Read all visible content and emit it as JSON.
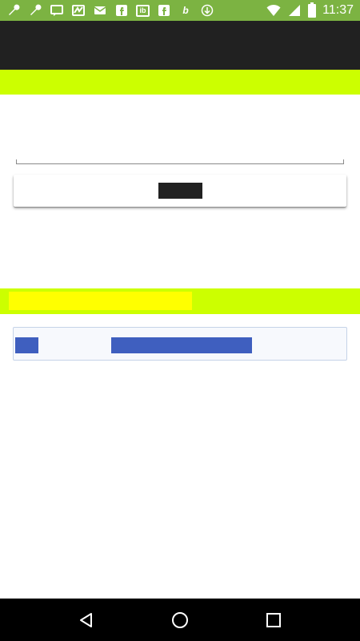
{
  "status_bar": {
    "time": "11:37",
    "icons": [
      "wrench-icon",
      "wrench-icon",
      "chat-icon",
      "wave-icon",
      "mail-icon",
      "f-icon",
      "ib-icon",
      "f-icon",
      "b-icon",
      "download-icon"
    ],
    "glyph_ib": "ib",
    "glyph_f": "f",
    "glyph_b": "b",
    "glyph_f2": "f",
    "colors": {
      "background": "#7cb342"
    }
  },
  "app_bar": {
    "title": "",
    "colors": {
      "background": "#212121"
    }
  },
  "form": {
    "input_value": "",
    "input_placeholder": "",
    "button_label": ""
  },
  "section": {
    "heading": "",
    "colors": {
      "band": "#ccff00",
      "highlight": "#ffff00"
    }
  },
  "link_row": {
    "left_link": "",
    "main_link": "",
    "colors": {
      "link": "#3f5fbf"
    }
  },
  "nav_bar": {
    "back_icon": "back-icon",
    "home_icon": "home-icon",
    "recents_icon": "recents-icon"
  }
}
